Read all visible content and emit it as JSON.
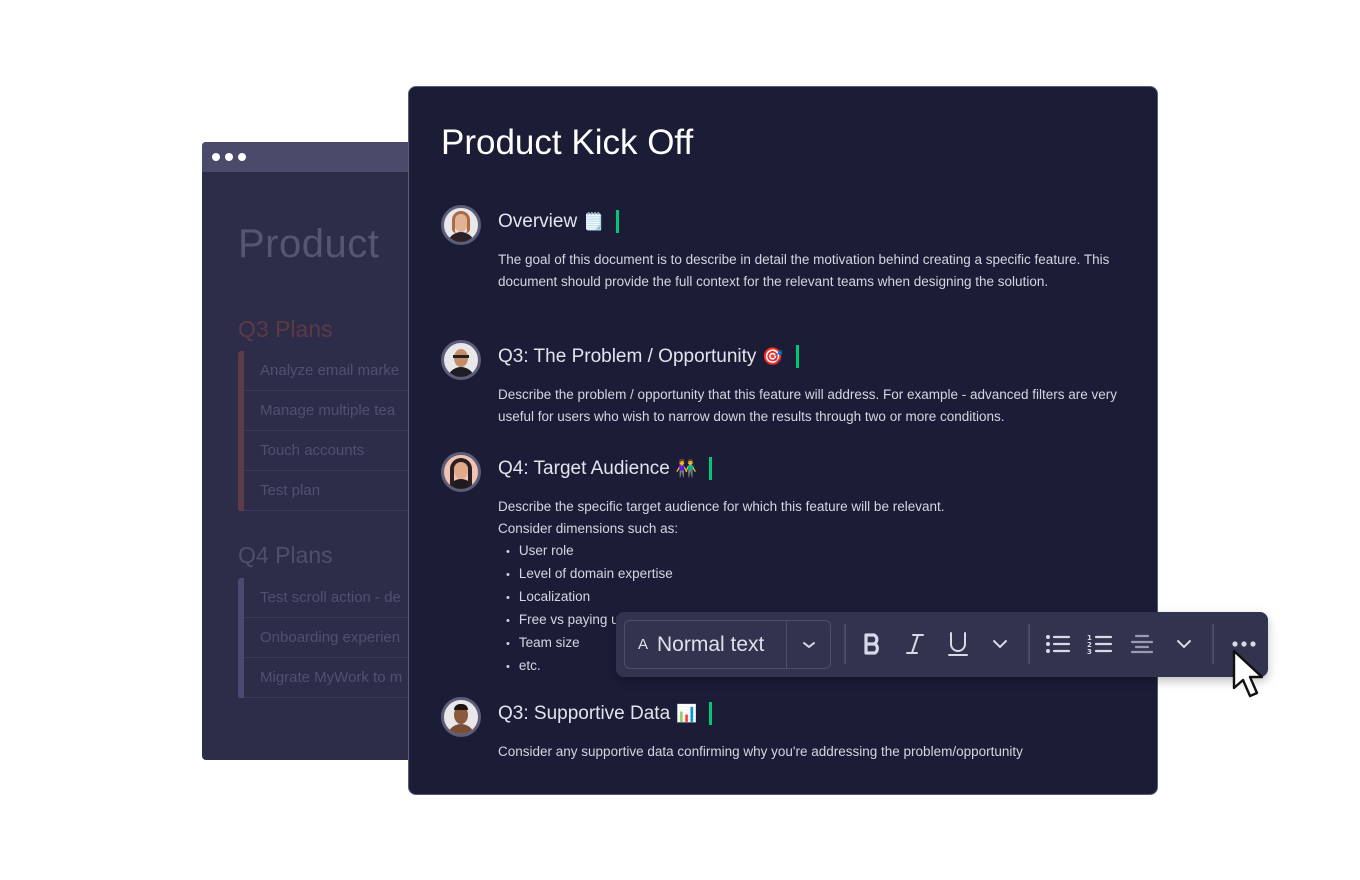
{
  "back_window": {
    "title": "Product",
    "groups": [
      {
        "title": "Q3 Plans",
        "color": "#5e3c47",
        "items": [
          "Analyze email marke",
          "Manage multiple tea",
          "Touch accounts",
          "Test plan"
        ]
      },
      {
        "title": "Q4 Plans",
        "color": "#4a4a72",
        "items": [
          "Test scroll action - de",
          "Onboarding experien",
          "Migrate MyWork to m"
        ]
      }
    ]
  },
  "document": {
    "title": "Product Kick Off",
    "cursor_color": "#00c875",
    "sections": [
      {
        "heading": "Overview",
        "emoji": "🗒️",
        "avatar": "woman-avatar",
        "body": "The goal of this document is to describe in detail the motivation behind creating a specific feature. This document should provide the full context for the relevant teams when designing the solution."
      },
      {
        "heading": "Q3: The Problem / Opportunity",
        "emoji": "🎯",
        "avatar": "man-glasses-avatar",
        "body": "Describe the problem / opportunity that this feature will address. For example - advanced filters are very useful for users who wish to narrow down the results through two or more conditions."
      },
      {
        "heading": "Q4: Target Audience",
        "emoji": "👫",
        "avatar": "woman-dark-hair-avatar",
        "body_lines": [
          "Describe the specific target audience for which this feature will be relevant.",
          "Consider dimensions such as:"
        ],
        "list": [
          "User role",
          "Level of domain expertise",
          "Localization",
          "Free vs paying u",
          "Team size",
          "etc."
        ]
      },
      {
        "heading": "Q3: Supportive Data",
        "emoji": "📊",
        "avatar": "man-avatar",
        "body": "Consider any supportive data confirming why you're addressing the problem/opportunity"
      }
    ]
  },
  "toolbar": {
    "text_style_icon": "A",
    "text_style": "Normal text",
    "buttons": [
      "bold",
      "italic",
      "underline",
      "more-format",
      "bullet-list",
      "numbered-list",
      "align-center",
      "more-align",
      "more-options"
    ]
  }
}
